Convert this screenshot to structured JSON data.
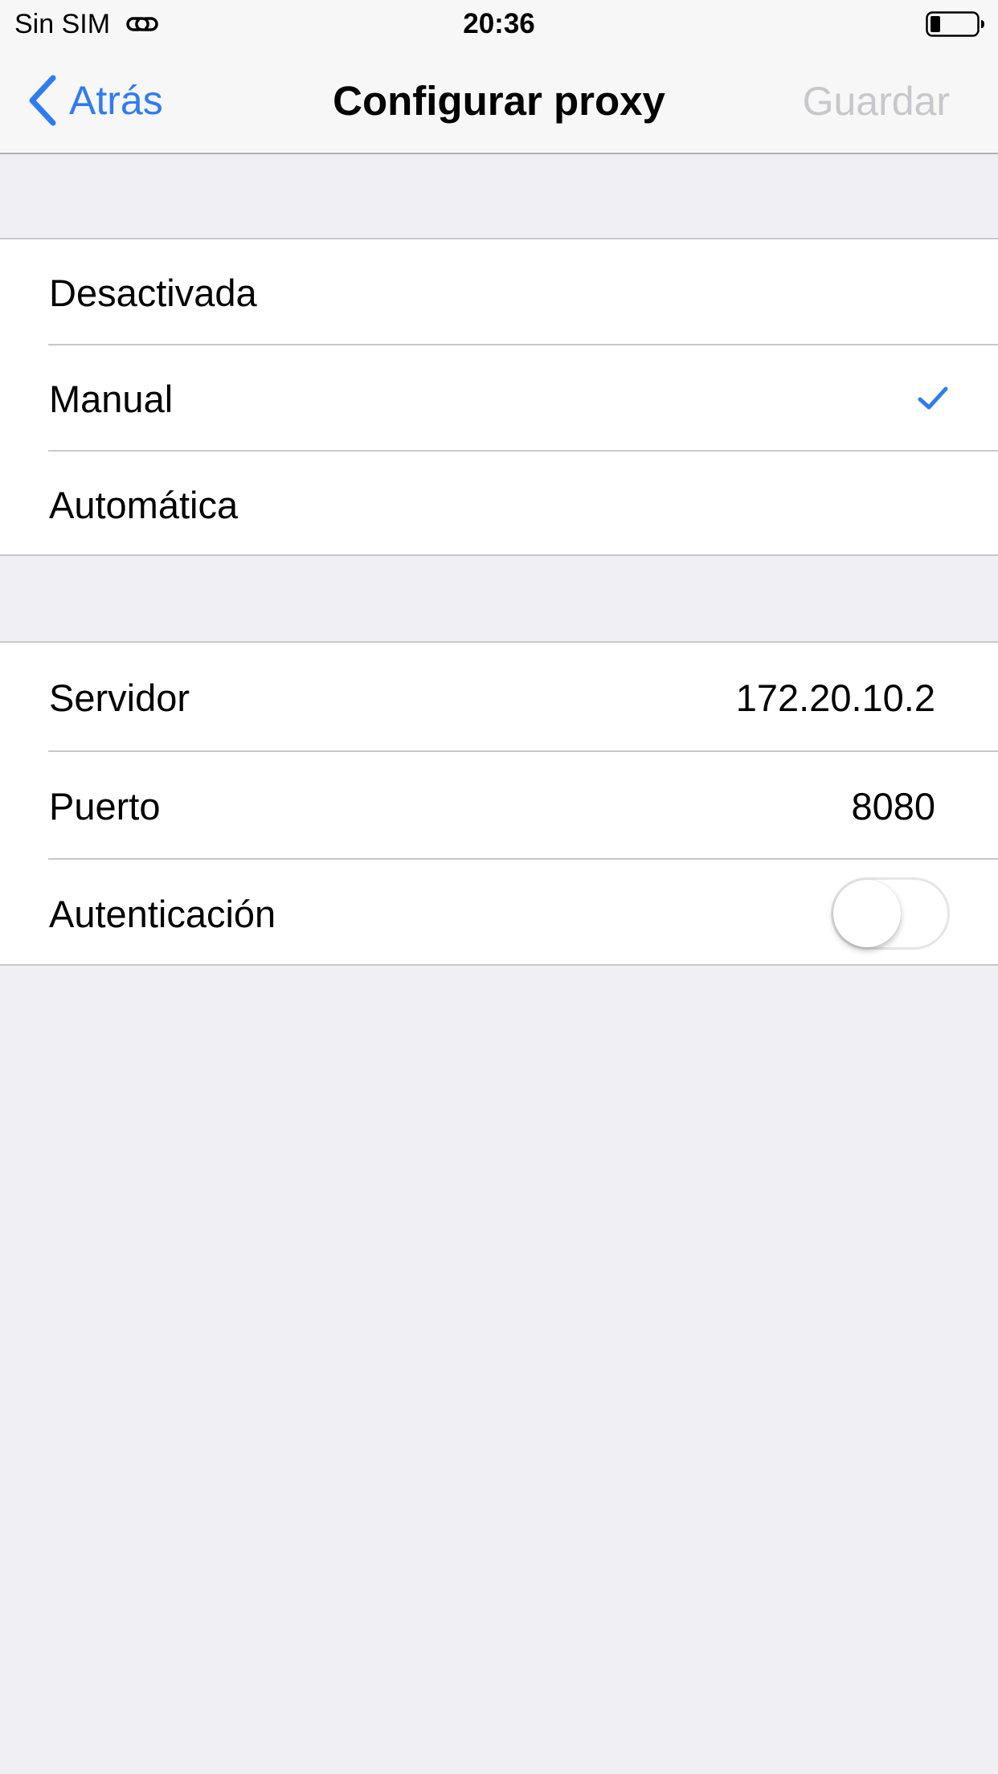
{
  "status_bar": {
    "carrier": "Sin SIM",
    "time": "20:36",
    "link_icon": "link-icon",
    "battery_icon": "battery-low-icon"
  },
  "nav": {
    "back_label": "Atrás",
    "title": "Configurar proxy",
    "save_label": "Guardar",
    "accent_color": "#2f7bf4",
    "disabled_color": "#c7c7cc"
  },
  "proxy_mode": {
    "options": [
      {
        "label": "Desactivada",
        "selected": false
      },
      {
        "label": "Manual",
        "selected": true
      },
      {
        "label": "Automática",
        "selected": false
      }
    ]
  },
  "manual_settings": {
    "server_label": "Servidor",
    "server_value": "172.20.10.2",
    "port_label": "Puerto",
    "port_value": "8080",
    "auth_label": "Autenticación",
    "auth_enabled": false
  }
}
